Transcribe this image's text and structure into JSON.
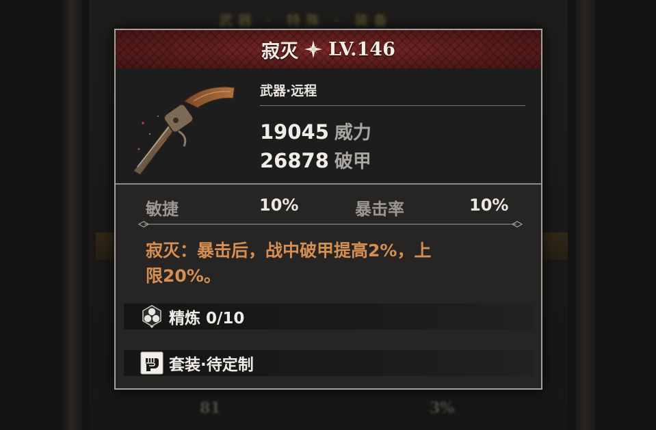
{
  "background": {
    "top_text": "武器 · 特殊 · 装备",
    "bottom_left": "81",
    "bottom_right": "3%"
  },
  "item": {
    "name": "寂灭",
    "level": "LV.146",
    "type": "武器·远程",
    "stats": [
      {
        "value": "19045",
        "label": "威力"
      },
      {
        "value": "26878",
        "label": "破甲"
      }
    ],
    "attributes": [
      {
        "label": "敏捷",
        "value": "10%"
      },
      {
        "label": "暴击率",
        "value": "10%"
      }
    ],
    "description_line1": "寂灭：暴击后，战中破甲提高2%，上",
    "description_line2": "限20%。",
    "refine_label": "精炼 0/10",
    "set_label": "套装·待定制"
  },
  "colors": {
    "title_bar": "#5a1c1c",
    "description": "#d58f52",
    "border": "#a6a39e"
  },
  "icons": {
    "title": "four-point-star-icon",
    "weapon": "revolver-icon",
    "refine": "hexagon-cluster-icon",
    "set": "fist-icon"
  }
}
